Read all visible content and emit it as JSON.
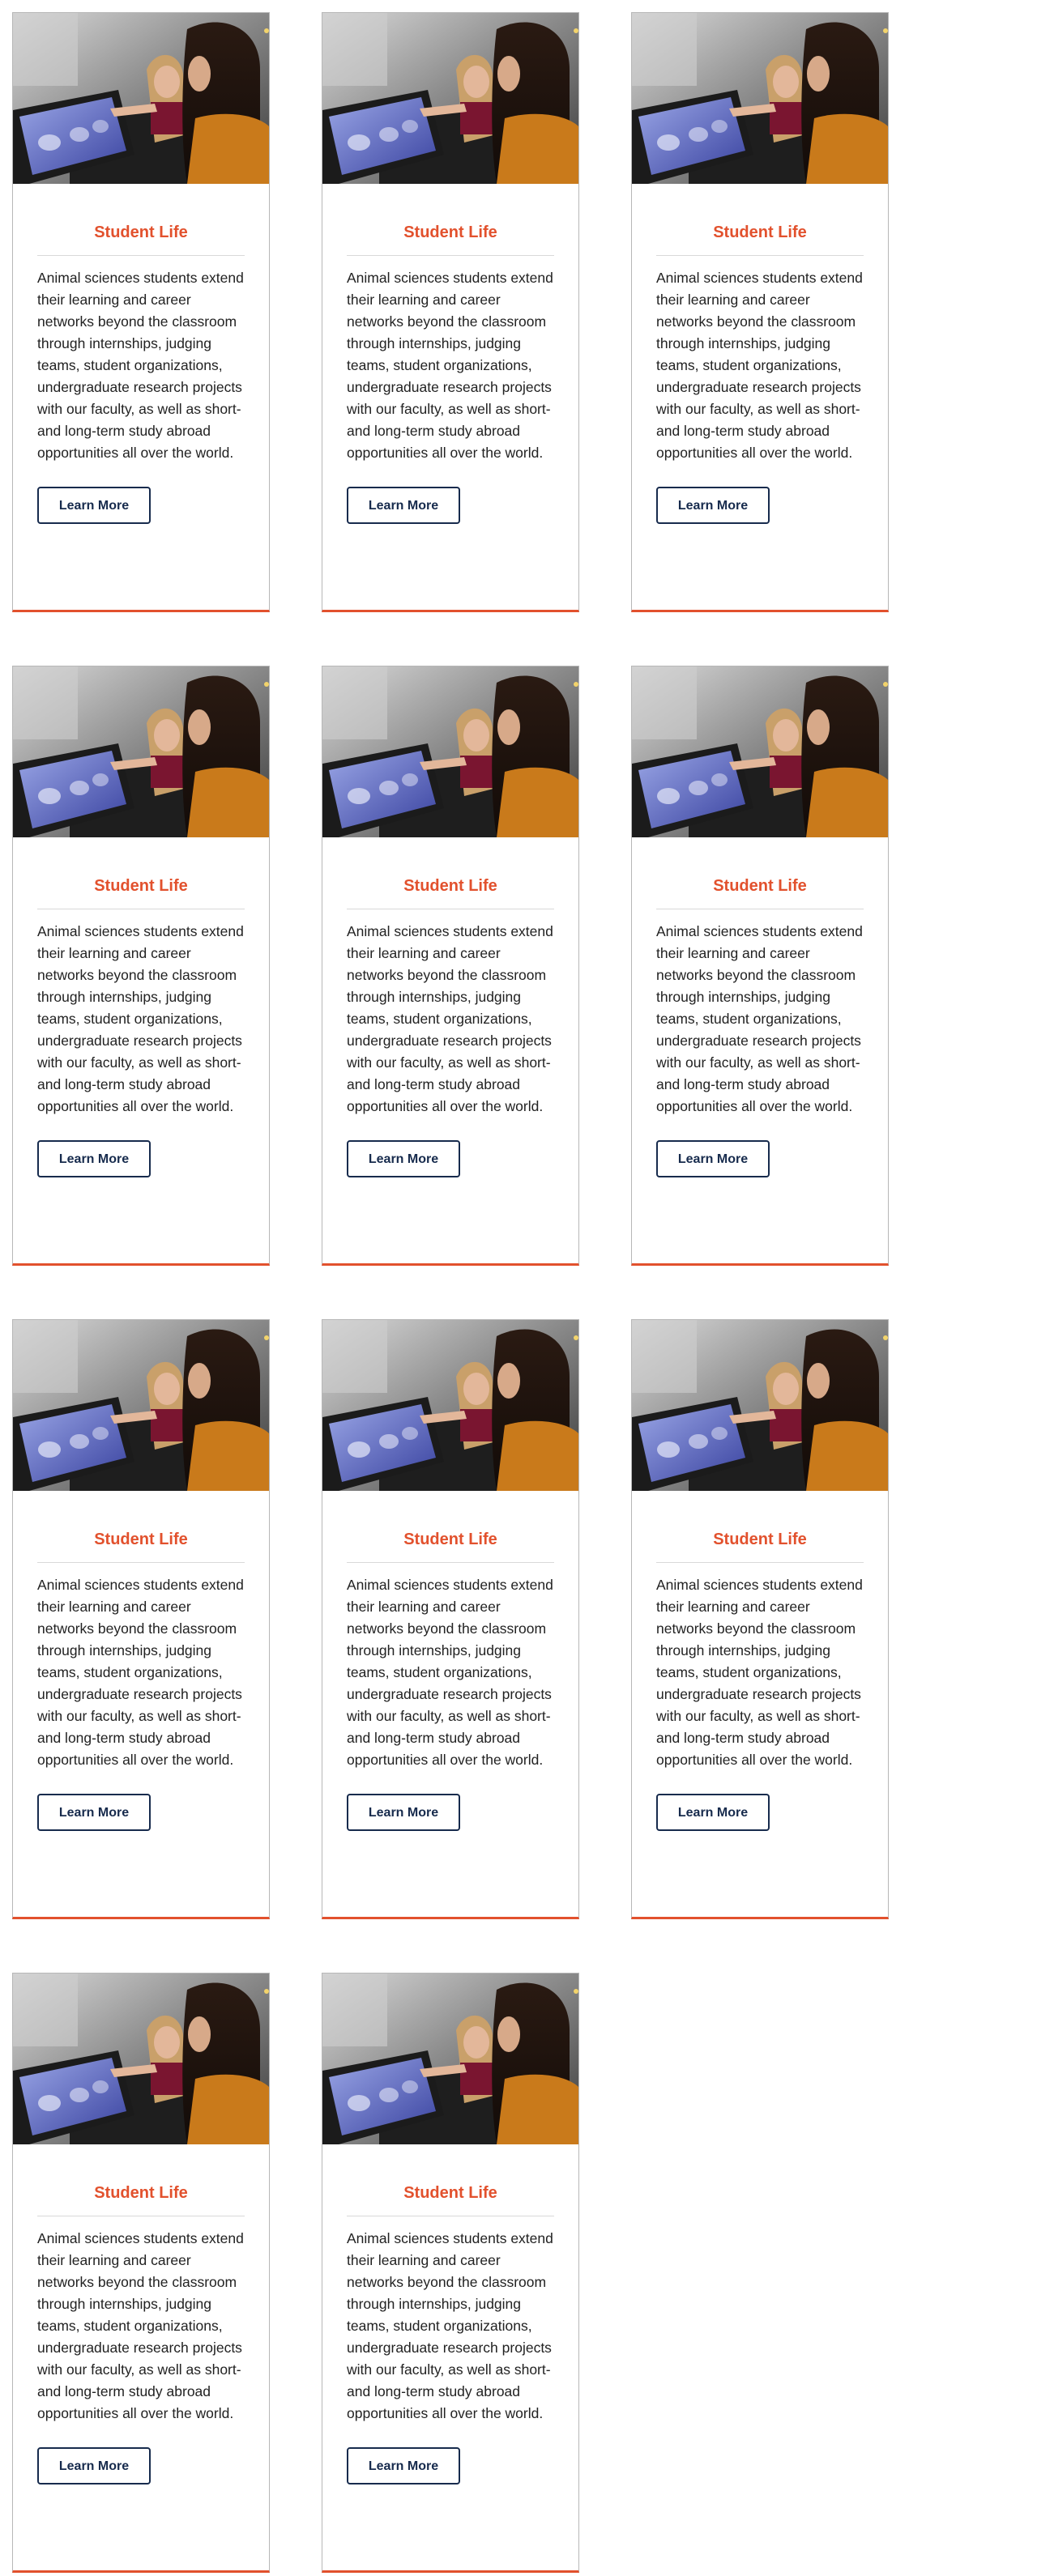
{
  "cards": [
    {
      "title": "Student Life",
      "body": "Animal sciences students extend their learning and career networks beyond the classroom through internships, judging teams, student organizations, undergraduate research projects with our faculty, as well as short- and long-term study abroad opportunities all over the world.",
      "button_label": "Learn More",
      "image_description": "two-students-viewing-touchscreen-photo"
    },
    {
      "title": "Student Life",
      "body": "Animal sciences students extend their learning and career networks beyond the classroom through internships, judging teams, student organizations, undergraduate research projects with our faculty, as well as short- and long-term study abroad opportunities all over the world.",
      "button_label": "Learn More",
      "image_description": "two-students-viewing-touchscreen-photo"
    },
    {
      "title": "Student Life",
      "body": "Animal sciences students extend their learning and career networks beyond the classroom through internships, judging teams, student organizations, undergraduate research projects with our faculty, as well as short- and long-term study abroad opportunities all over the world.",
      "button_label": "Learn More",
      "image_description": "two-students-viewing-touchscreen-photo"
    },
    {
      "title": "Student Life",
      "body": "Animal sciences students extend their learning and career networks beyond the classroom through internships, judging teams, student organizations, undergraduate research projects with our faculty, as well as short- and long-term study abroad opportunities all over the world.",
      "button_label": "Learn More",
      "image_description": "two-students-viewing-touchscreen-photo"
    },
    {
      "title": "Student Life",
      "body": "Animal sciences students extend their learning and career networks beyond the classroom through internships, judging teams, student organizations, undergraduate research projects with our faculty, as well as short- and long-term study abroad opportunities all over the world.",
      "button_label": "Learn More",
      "image_description": "two-students-viewing-touchscreen-photo"
    },
    {
      "title": "Student Life",
      "body": "Animal sciences students extend their learning and career networks beyond the classroom through internships, judging teams, student organizations, undergraduate research projects with our faculty, as well as short- and long-term study abroad opportunities all over the world.",
      "button_label": "Learn More",
      "image_description": "two-students-viewing-touchscreen-photo"
    },
    {
      "title": "Student Life",
      "body": "Animal sciences students extend their learning and career networks beyond the classroom through internships, judging teams, student organizations, undergraduate research projects with our faculty, as well as short- and long-term study abroad opportunities all over the world.",
      "button_label": "Learn More",
      "image_description": "two-students-viewing-touchscreen-photo"
    },
    {
      "title": "Student Life",
      "body": "Animal sciences students extend their learning and career networks beyond the classroom through internships, judging teams, student organizations, undergraduate research projects with our faculty, as well as short- and long-term study abroad opportunities all over the world.",
      "button_label": "Learn More",
      "image_description": "two-students-viewing-touchscreen-photo"
    },
    {
      "title": "Student Life",
      "body": "Animal sciences students extend their learning and career networks beyond the classroom through internships, judging teams, student organizations, undergraduate research projects with our faculty, as well as short- and long-term study abroad opportunities all over the world.",
      "button_label": "Learn More",
      "image_description": "two-students-viewing-touchscreen-photo"
    },
    {
      "title": "Student Life",
      "body": "Animal sciences students extend their learning and career networks beyond the classroom through internships, judging teams, student organizations, undergraduate research projects with our faculty, as well as short- and long-term study abroad opportunities all over the world.",
      "button_label": "Learn More",
      "image_description": "two-students-viewing-touchscreen-photo"
    },
    {
      "title": "Student Life",
      "body": "Animal sciences students extend their learning and career networks beyond the classroom through internships, judging teams, student organizations, undergraduate research projects with our faculty, as well as short- and long-term study abroad opportunities all over the world.",
      "button_label": "Learn More",
      "image_description": "two-students-viewing-touchscreen-photo"
    }
  ],
  "colors": {
    "accent": "#e2512d",
    "button_border": "#172b4d",
    "card_border": "#b7b7b7",
    "divider": "#d9d9d9"
  }
}
